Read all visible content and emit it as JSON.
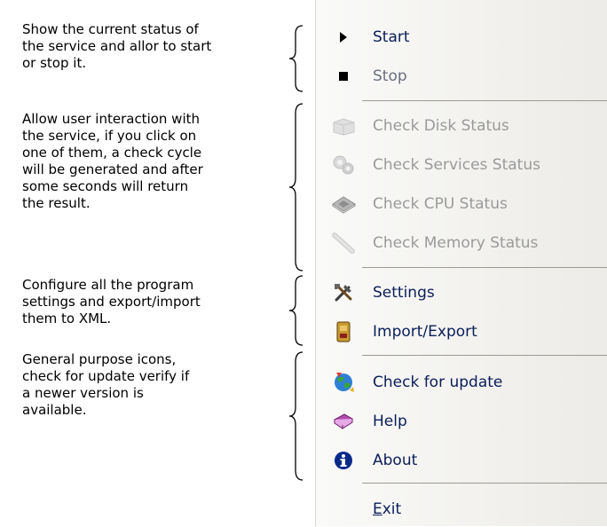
{
  "annotations": {
    "service": "Show the current status of\nthe service and allor to start\nor stop it.",
    "checks": "Allow user interaction with\nthe service, if you click on\none of them, a check cycle\nwill be generated and after\nsome seconds will return\nthe result.",
    "settings": "Configure all the program\nsettings and export/import\nthem to XML.",
    "general": "General purpose icons,\ncheck for update verify if\na newer version is\navailable."
  },
  "menu": {
    "start": {
      "label": "Start",
      "icon": "play-icon",
      "enabled": true
    },
    "stop": {
      "label": "Stop",
      "icon": "stop-icon",
      "enabled": true
    },
    "check_disk": {
      "label": "Check Disk Status",
      "icon": "disk-icon",
      "enabled": false
    },
    "check_services": {
      "label": "Check Services Status",
      "icon": "services-icon",
      "enabled": false
    },
    "check_cpu": {
      "label": "Check CPU Status",
      "icon": "cpu-icon",
      "enabled": false
    },
    "check_memory": {
      "label": "Check Memory Status",
      "icon": "memory-icon",
      "enabled": false
    },
    "settings": {
      "label": "Settings",
      "icon": "tools-icon",
      "enabled": true
    },
    "import_export": {
      "label": "Import/Export",
      "icon": "import-export-icon",
      "enabled": true
    },
    "check_update": {
      "label": "Check for update",
      "icon": "globe-update-icon",
      "enabled": true
    },
    "help": {
      "label": "Help",
      "icon": "help-book-icon",
      "enabled": true
    },
    "about": {
      "label": "About",
      "icon": "info-icon",
      "enabled": true
    },
    "exit": {
      "label_mnemonic": "E",
      "label_rest": "xit",
      "enabled": true
    }
  },
  "colors": {
    "menu_text": "#0a1e58",
    "disabled_text": "#9a9a9a",
    "separator": "#9d9a93"
  }
}
